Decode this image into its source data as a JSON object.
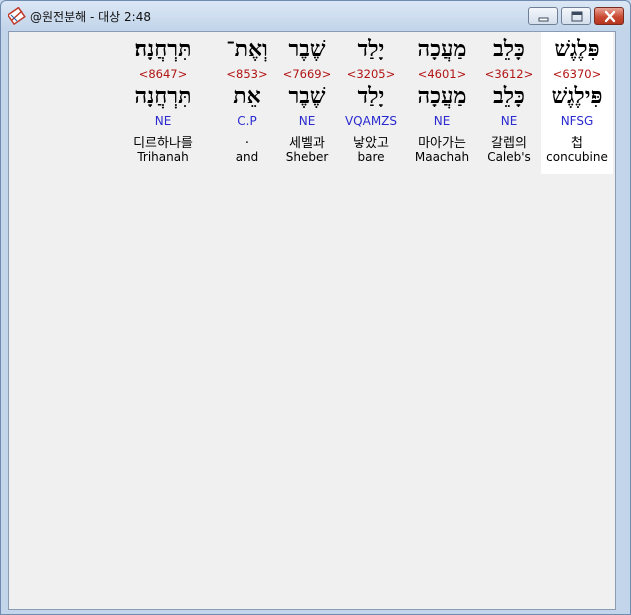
{
  "window": {
    "title": "@원전분해 - 대상 2:48"
  },
  "words": [
    {
      "hebrew": "תִּרְחֲנָה׃",
      "strong": "<8647>",
      "lemma": "תִּרְחֲנָה",
      "morph": "NE",
      "korean": "디르하나를",
      "english": "Trihanah"
    },
    {
      "hebrew": "וְאֶת־",
      "strong": "<853>",
      "lemma": "אֵת",
      "morph": "C.P",
      "korean": ".",
      "english": "and"
    },
    {
      "hebrew": "שֶׁבֶר",
      "strong": "<7669>",
      "lemma": "שֶׁבֶר",
      "morph": "NE",
      "korean": "세벨과",
      "english": "Sheber"
    },
    {
      "hebrew": "יָלַד",
      "strong": "<3205>",
      "lemma": "יָלַד",
      "morph": "VQAMZS",
      "korean": "낳았고",
      "english": "bare"
    },
    {
      "hebrew": "מַעֲכָה",
      "strong": "<4601>",
      "lemma": "מַעֲכָה",
      "morph": "NE",
      "korean": "마아가는",
      "english": "Maachah"
    },
    {
      "hebrew": "כָּלֵב",
      "strong": "<3612>",
      "lemma": "כָּלֵב",
      "morph": "NE",
      "korean": "갈렙의",
      "english": "Caleb's"
    },
    {
      "hebrew": "פִּלֶגֶשׁ",
      "strong": "<6370>",
      "lemma": "פִּילֶגֶשׁ",
      "morph": "NFSG",
      "korean": "첩",
      "english": "concubine"
    }
  ]
}
